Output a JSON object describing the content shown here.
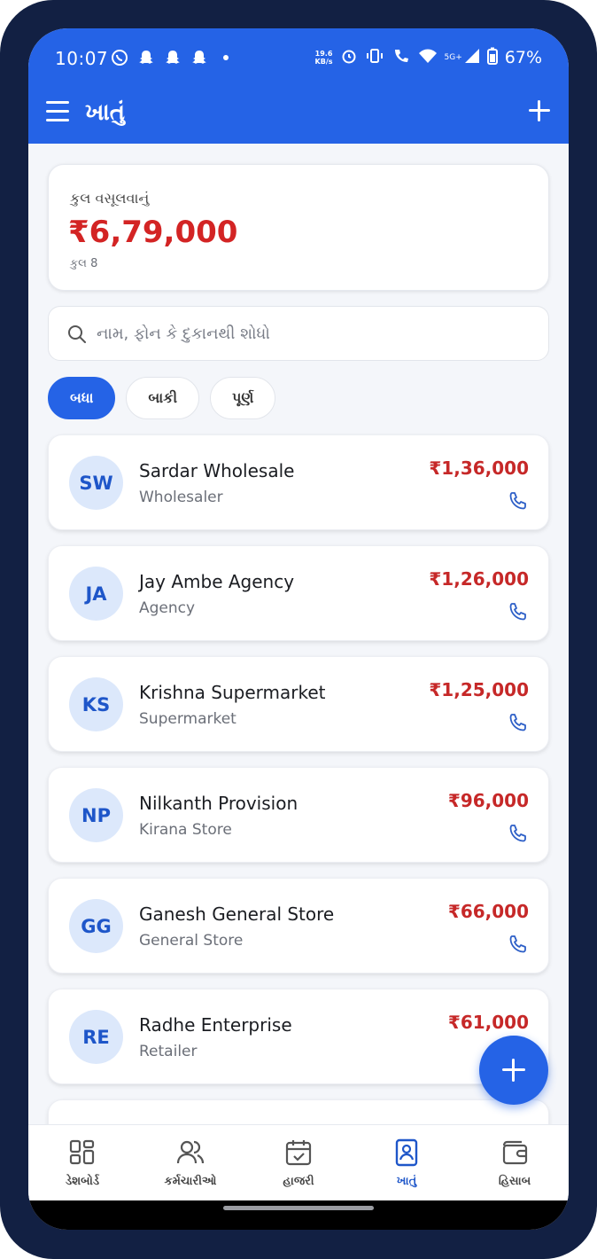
{
  "status": {
    "time": "10:07",
    "net_speed_top": "19.6",
    "net_speed_unit": "KB/s",
    "network": "5G+",
    "battery": "67%"
  },
  "appbar": {
    "title": "ખાતું"
  },
  "summary": {
    "label": "કુલ વસૂલવાનું",
    "amount": "₹6,79,000",
    "count": "કુલ 8"
  },
  "search": {
    "placeholder": "નામ, ફોન કે દુકાનથી શોધો",
    "value": ""
  },
  "filters": [
    {
      "label": "બધા",
      "active": true
    },
    {
      "label": "બાકી",
      "active": false
    },
    {
      "label": "પૂર્ણ",
      "active": false
    }
  ],
  "accounts": [
    {
      "initials": "SW",
      "name": "Sardar Wholesale",
      "type": "Wholesaler",
      "amount": "₹1,36,000"
    },
    {
      "initials": "JA",
      "name": "Jay Ambe Agency",
      "type": "Agency",
      "amount": "₹1,26,000"
    },
    {
      "initials": "KS",
      "name": "Krishna Supermarket",
      "type": "Supermarket",
      "amount": "₹1,25,000"
    },
    {
      "initials": "NP",
      "name": "Nilkanth Provision",
      "type": "Kirana Store",
      "amount": "₹96,000"
    },
    {
      "initials": "GG",
      "name": "Ganesh General Store",
      "type": "General Store",
      "amount": "₹66,000"
    },
    {
      "initials": "RE",
      "name": "Radhe Enterprise",
      "type": "Retailer",
      "amount": "₹61,000"
    }
  ],
  "nav": [
    {
      "label": "ડેશબોર્ડ",
      "icon": "dashboard-icon"
    },
    {
      "label": "કર્મચારીઓ",
      "icon": "employees-icon"
    },
    {
      "label": "હાજરી",
      "icon": "attendance-icon"
    },
    {
      "label": "ખાતું",
      "icon": "accounts-icon",
      "active": true
    },
    {
      "label": "હિસાબ",
      "icon": "wallet-icon"
    }
  ],
  "colors": {
    "primary": "#2563e6",
    "amount_red": "#c62828",
    "avatar_bg": "#dce8fb"
  }
}
